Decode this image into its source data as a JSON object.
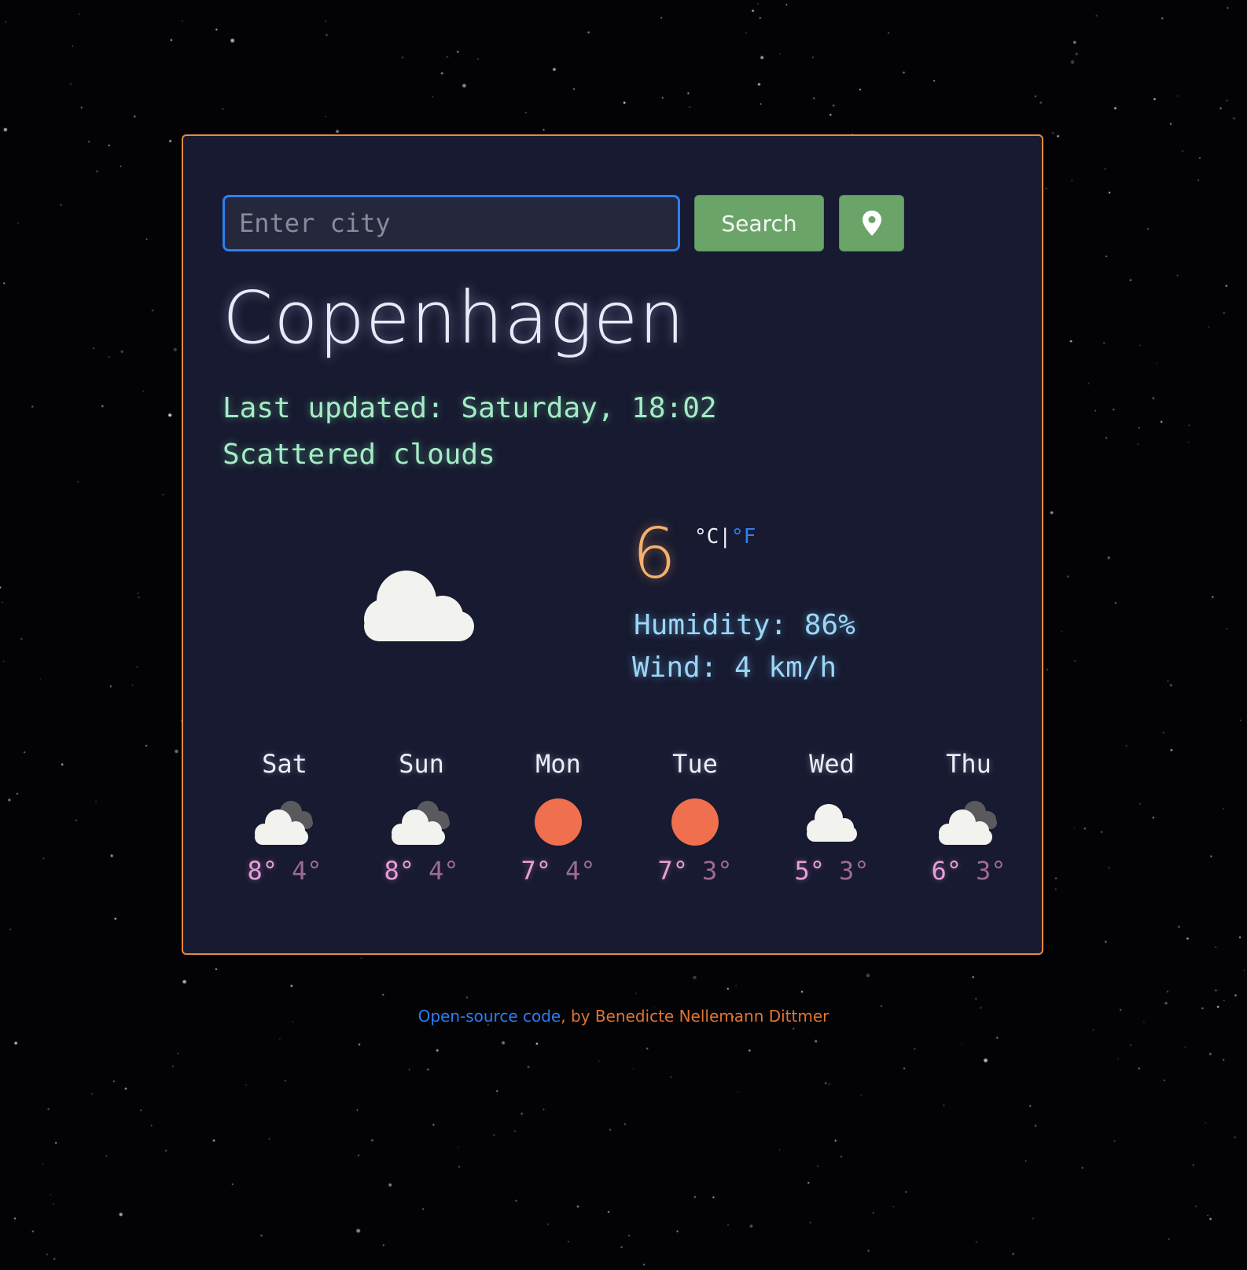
{
  "search": {
    "placeholder": "Enter city",
    "value": "",
    "button_label": "Search",
    "location_icon": "map-pin-icon"
  },
  "current": {
    "city": "Copenhagen",
    "last_updated": "Last updated: Saturday, 18:02",
    "description": "Scattered clouds",
    "icon": "cloud-icon",
    "temperature": "6",
    "unit_celsius": "°C",
    "unit_separator": "|",
    "unit_fahrenheit": "°F",
    "humidity": "Humidity: 86%",
    "wind": "Wind: 4 km/h"
  },
  "forecast": [
    {
      "day": "Sat",
      "max": "8°",
      "min": "4°",
      "icon": "broken-clouds-icon"
    },
    {
      "day": "Sun",
      "max": "8°",
      "min": "4°",
      "icon": "broken-clouds-icon"
    },
    {
      "day": "Mon",
      "max": "7°",
      "min": "4°",
      "icon": "sun-icon"
    },
    {
      "day": "Tue",
      "max": "7°",
      "min": "3°",
      "icon": "sun-icon"
    },
    {
      "day": "Wed",
      "max": "5°",
      "min": "3°",
      "icon": "cloud-icon"
    },
    {
      "day": "Thu",
      "max": "6°",
      "min": "3°",
      "icon": "broken-clouds-icon"
    }
  ],
  "footer": {
    "link_text": "Open-source code",
    "author_text": ", by Benedicte Nellemann Dittmer"
  },
  "colors": {
    "card_border": "#e8893e",
    "card_background": "#171a30",
    "button_green": "#6aa469",
    "input_focus_blue": "#2f7ef0",
    "sun_orange": "#ef6f4e"
  }
}
